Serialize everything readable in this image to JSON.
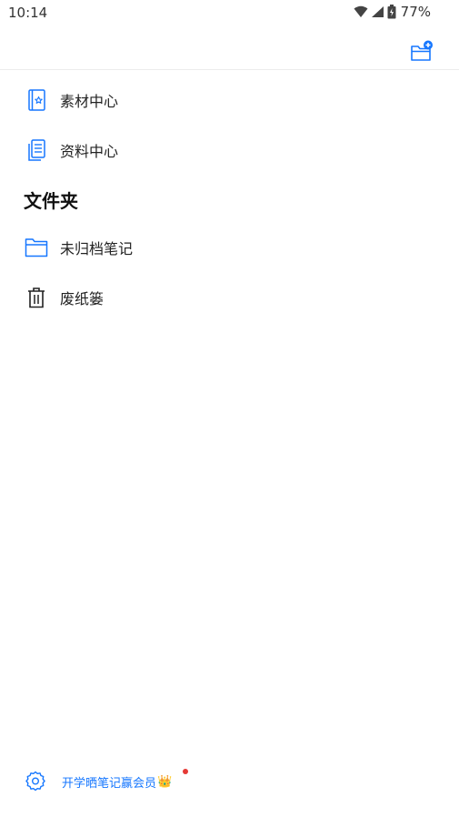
{
  "status_bar": {
    "time": "10:14",
    "battery": "77%"
  },
  "nav": {
    "items": [
      {
        "label": "素材中心",
        "icon": "material-book-icon"
      },
      {
        "label": "资料中心",
        "icon": "document-icon"
      }
    ]
  },
  "folders": {
    "title": "文件夹",
    "items": [
      {
        "label": "未归档笔记",
        "icon": "folder-icon"
      },
      {
        "label": "废纸篓",
        "icon": "trash-icon"
      }
    ]
  },
  "footer": {
    "promo": "开学晒笔记赢会员",
    "crown": "👑"
  },
  "colors": {
    "accent": "#1677ff",
    "notification_dot": "#e53935"
  }
}
